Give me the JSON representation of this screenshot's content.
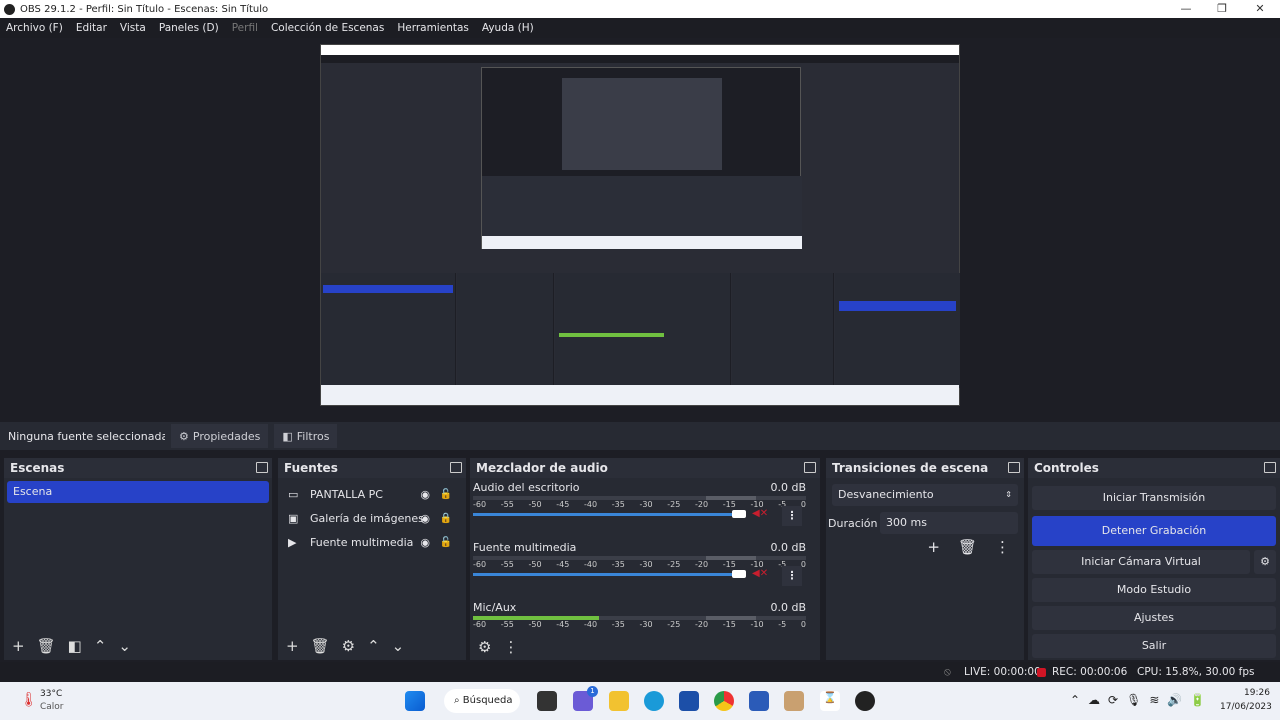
{
  "window": {
    "title": "OBS 29.1.2 - Perfil: Sin Título - Escenas: Sin Título",
    "minimize": "—",
    "maximize": "❐",
    "close": "✕"
  },
  "menu": [
    "Archivo (F)",
    "Editar",
    "Vista",
    "Paneles (D)",
    "Perfil",
    "Colección de Escenas",
    "Herramientas",
    "Ayuda (H)"
  ],
  "source_toolbar": {
    "no_selection": "Ninguna fuente seleccionada",
    "properties": "Propiedades",
    "filters": "Filtros"
  },
  "scenes": {
    "title": "Escenas",
    "items": [
      "Escena"
    ]
  },
  "sources": {
    "title": "Fuentes",
    "items": [
      {
        "name": "PANTALLA PC",
        "icon": "monitor-icon"
      },
      {
        "name": "Galería de imágenes",
        "icon": "slideshow-icon"
      },
      {
        "name": "Fuente multimedia",
        "icon": "play-icon"
      }
    ]
  },
  "mixer": {
    "title": "Mezclador de audio",
    "ticks": [
      "-60",
      "-55",
      "-50",
      "-45",
      "-40",
      "-35",
      "-30",
      "-25",
      "-20",
      "-15",
      "-10",
      "-5",
      "0"
    ],
    "channels": [
      {
        "name": "Audio del escritorio",
        "db": "0.0 dB",
        "volume": 1.0,
        "muted": true
      },
      {
        "name": "Fuente multimedia",
        "db": "0.0 dB",
        "volume": 1.0,
        "muted": true
      },
      {
        "name": "Mic/Aux",
        "db": "0.0 dB",
        "level": 0.38
      }
    ]
  },
  "transitions": {
    "title": "Transiciones de escena",
    "selected": "Desvanecimiento",
    "duration_label": "Duración",
    "duration": "300 ms"
  },
  "controls": {
    "title": "Controles",
    "start_stream": "Iniciar Transmisión",
    "stop_record": "Detener Grabación",
    "virtual_cam": "Iniciar Cámara Virtual",
    "studio": "Modo Estudio",
    "settings": "Ajustes",
    "exit": "Salir"
  },
  "status": {
    "live": "LIVE: 00:00:00",
    "rec": "REC: 00:00:06",
    "cpu": "CPU: 15.8%, 30.00 fps"
  },
  "taskbar": {
    "temp": "33°C",
    "weather": "Calor",
    "search": "Búsqueda",
    "time": "19:26",
    "date": "17/06/2023",
    "chat_badge": "1"
  }
}
